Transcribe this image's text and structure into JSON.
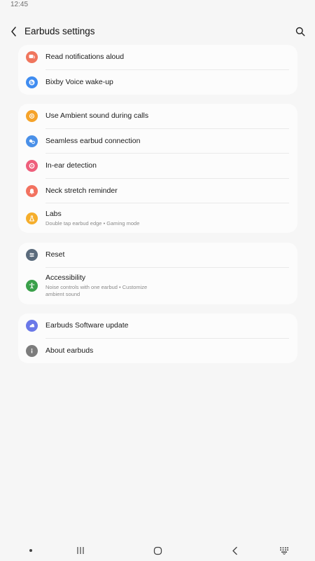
{
  "status_bar": {
    "time": "12:45"
  },
  "header": {
    "title": "Earbuds settings"
  },
  "cards": [
    {
      "items": [
        {
          "label": "Read notifications aloud",
          "icon": "notification-speech-icon",
          "color": "#f0765e"
        },
        {
          "label": "Bixby Voice wake-up",
          "icon": "bixby-icon",
          "color": "#3f8cf0"
        }
      ]
    },
    {
      "items": [
        {
          "label": "Use Ambient sound during calls",
          "icon": "ambient-sound-icon",
          "color": "#f5a32a"
        },
        {
          "label": "Seamless earbud connection",
          "icon": "earbud-connection-icon",
          "color": "#4a90e8"
        },
        {
          "label": "In-ear detection",
          "icon": "in-ear-detection-icon",
          "color": "#ee5f7c"
        },
        {
          "label": "Neck stretch reminder",
          "icon": "bell-icon",
          "color": "#f27260"
        },
        {
          "label": "Labs",
          "sub": "Double tap earbud edge • Gaming mode",
          "icon": "labs-flask-icon",
          "color": "#f5ae2c"
        }
      ]
    },
    {
      "items": [
        {
          "label": "Reset",
          "icon": "reset-sliders-icon",
          "color": "#5b6b7c"
        },
        {
          "label": "Accessibility",
          "sub": "Noise controls with one earbud • Customize ambient sound",
          "icon": "accessibility-icon",
          "color": "#3aa04a"
        }
      ]
    },
    {
      "items": [
        {
          "label": "Earbuds Software update",
          "icon": "software-update-icon",
          "color": "#6a78e8"
        },
        {
          "label": "About earbuds",
          "icon": "info-icon",
          "color": "#7c7c7c"
        }
      ]
    }
  ]
}
